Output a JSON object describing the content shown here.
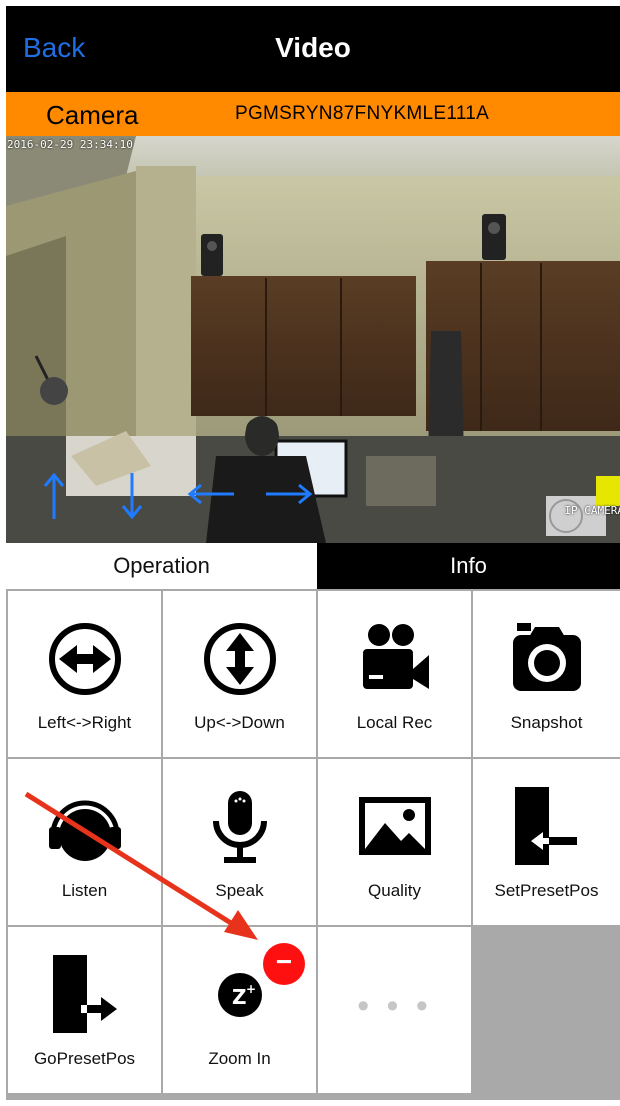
{
  "nav": {
    "back_label": "Back",
    "title": "Video"
  },
  "camera_bar": {
    "label": "Camera",
    "id": "PGMSRYN87FNYKMLE111A"
  },
  "video": {
    "timestamp": "2016-02-29 23:34:10",
    "watermark": "IP CAMERA"
  },
  "tabs": {
    "operation": "Operation",
    "info": "Info"
  },
  "grid": {
    "items": [
      {
        "label": "Left<->Right",
        "icon": "left-right-icon"
      },
      {
        "label": "Up<->Down",
        "icon": "up-down-icon"
      },
      {
        "label": "Local Rec",
        "icon": "video-camera-icon"
      },
      {
        "label": "Snapshot",
        "icon": "camera-icon"
      },
      {
        "label": "Listen",
        "icon": "headphones-icon"
      },
      {
        "label": "Speak",
        "icon": "microphone-icon"
      },
      {
        "label": "Quality",
        "icon": "image-icon"
      },
      {
        "label": "SetPresetPos",
        "icon": "set-preset-icon"
      },
      {
        "label": "GoPresetPos",
        "icon": "go-preset-icon"
      },
      {
        "label": "Zoom In",
        "icon": "zoom-in-icon"
      },
      {
        "label": "",
        "icon": "more-icon"
      }
    ],
    "zoom_badge": "−",
    "more_dots": "• • •",
    "zoom_glyph": "Z",
    "zoom_sup": "+"
  },
  "colors": {
    "accent": "#1e6fe4",
    "camera_bar": "#ff8a00",
    "badge": "#ff1010",
    "arrow": "#e8331c"
  }
}
